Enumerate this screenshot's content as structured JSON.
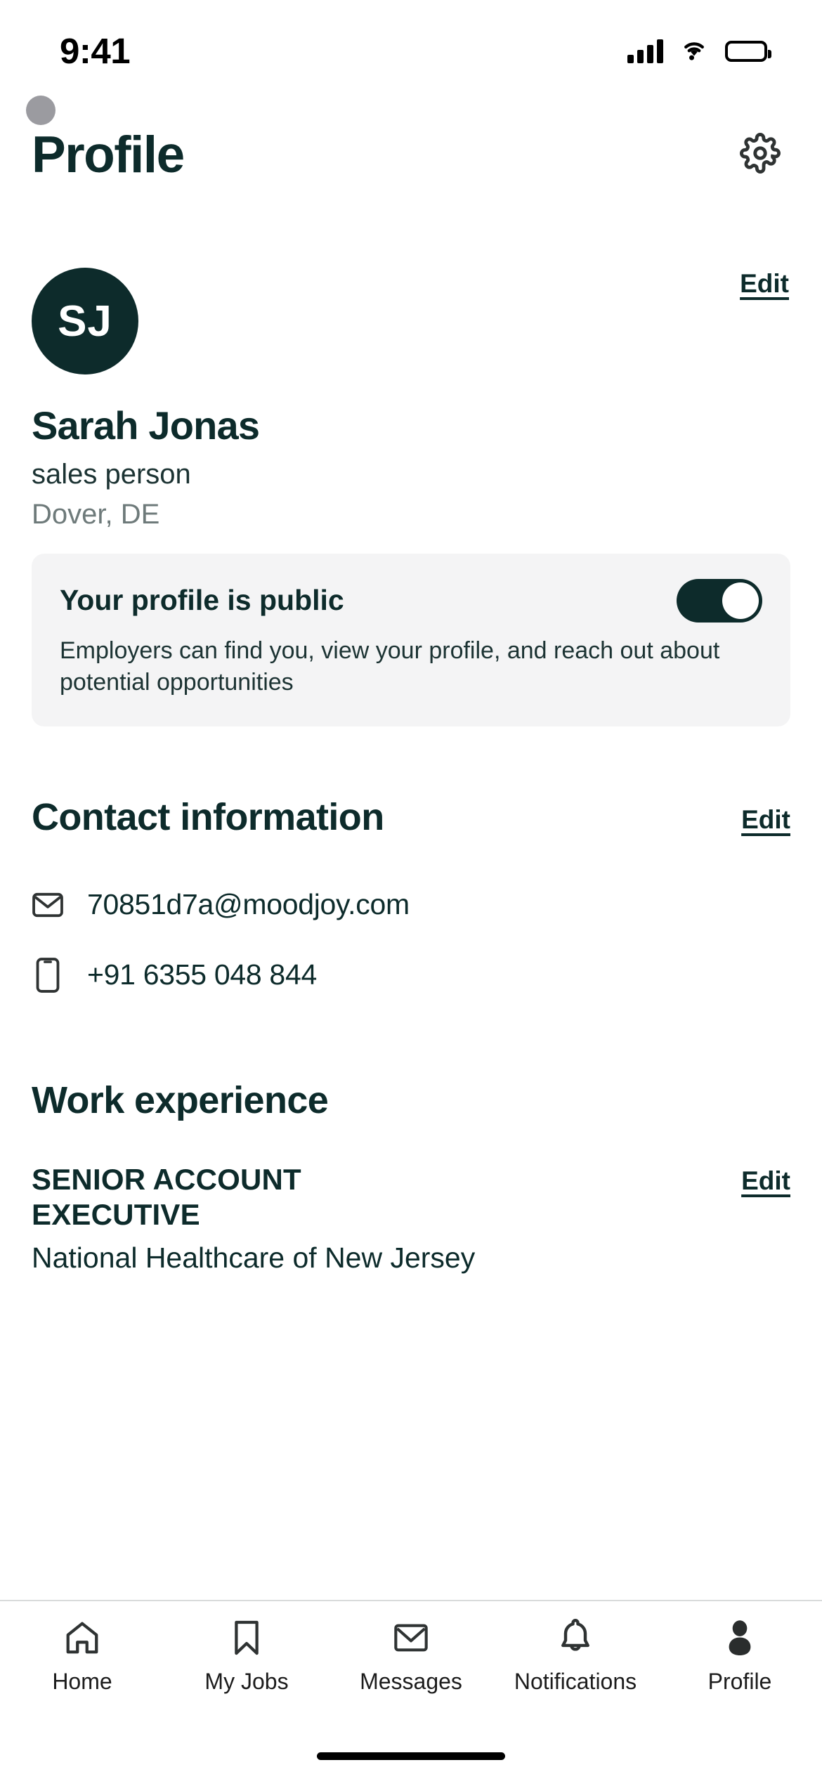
{
  "status_bar": {
    "time": "9:41",
    "signal_icon": "signal-bars-icon",
    "wifi_icon": "wifi-icon",
    "battery_icon": "battery-icon"
  },
  "header": {
    "title": "Profile",
    "settings_icon": "gear-icon"
  },
  "profile": {
    "avatar_initials": "SJ",
    "edit_label": "Edit",
    "name": "Sarah Jonas",
    "role": "sales person",
    "location": "Dover, DE",
    "avatar_bg": "#0D2B2B"
  },
  "public_card": {
    "title": "Your profile is public",
    "description": "Employers can find you, view your profile, and reach out about potential opportunities",
    "toggle_on": true,
    "toggle_track_color": "#0D2B2B",
    "card_bg": "#F4F4F5"
  },
  "contact": {
    "section_title": "Contact information",
    "edit_label": "Edit",
    "items": [
      {
        "icon": "envelope-icon",
        "value": "70851d7a@moodjoy.com"
      },
      {
        "icon": "phone-icon",
        "value": "+91 6355 048 844"
      }
    ]
  },
  "work": {
    "section_title": "Work experience",
    "jobs": [
      {
        "title": "SENIOR ACCOUNT EXECUTIVE",
        "company": "National Healthcare of New Jersey",
        "edit_label": "Edit"
      }
    ]
  },
  "tab_bar": {
    "active": "Profile",
    "items": [
      {
        "label": "Home",
        "icon": "home-icon"
      },
      {
        "label": "My Jobs",
        "icon": "bookmark-icon"
      },
      {
        "label": "Messages",
        "icon": "envelope-icon"
      },
      {
        "label": "Notifications",
        "icon": "bell-icon"
      },
      {
        "label": "Profile",
        "icon": "person-icon"
      }
    ]
  }
}
